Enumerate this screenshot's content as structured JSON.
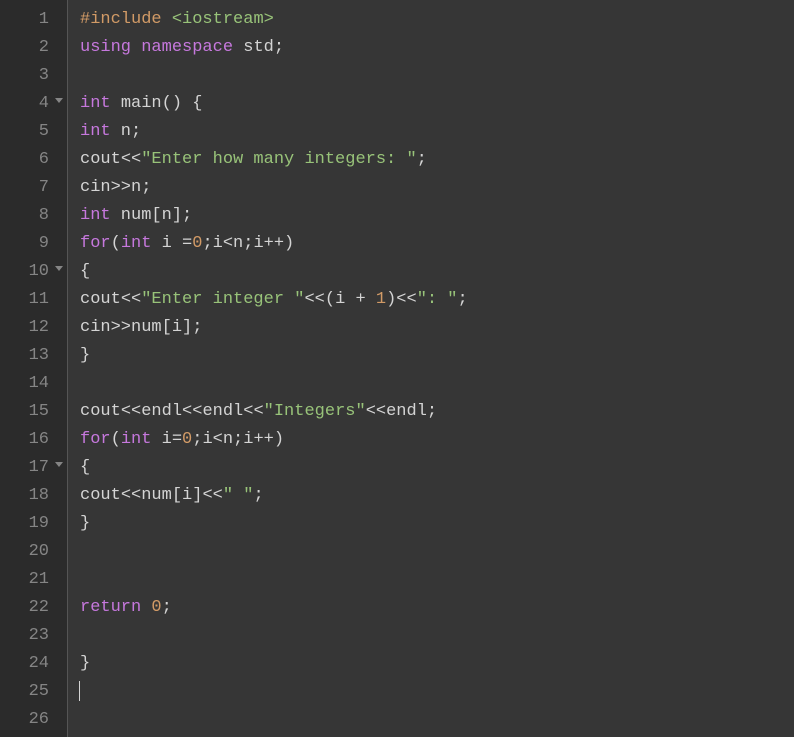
{
  "gutter": {
    "lines": [
      "1",
      "2",
      "3",
      "4",
      "5",
      "6",
      "7",
      "8",
      "9",
      "10",
      "11",
      "12",
      "13",
      "14",
      "15",
      "16",
      "17",
      "18",
      "19",
      "20",
      "21",
      "22",
      "23",
      "24",
      "25",
      "26"
    ],
    "fold_lines": [
      4,
      10,
      17
    ]
  },
  "code": {
    "lines": [
      [
        {
          "t": "#include ",
          "c": "kw-orange"
        },
        {
          "t": "<iostream>",
          "c": "string"
        }
      ],
      [
        {
          "t": "using",
          "c": "kw-blue"
        },
        {
          "t": " ",
          "c": "ident"
        },
        {
          "t": "namespace",
          "c": "kw-blue"
        },
        {
          "t": " std",
          "c": "ident"
        },
        {
          "t": ";",
          "c": "punct"
        }
      ],
      [],
      [
        {
          "t": "int",
          "c": "kw-blue"
        },
        {
          "t": " ",
          "c": "ident"
        },
        {
          "t": "main",
          "c": "fn-name"
        },
        {
          "t": "() {",
          "c": "punct"
        }
      ],
      [
        {
          "t": "int",
          "c": "kw-blue"
        },
        {
          "t": " n",
          "c": "ident"
        },
        {
          "t": ";",
          "c": "punct"
        }
      ],
      [
        {
          "t": "cout",
          "c": "ident"
        },
        {
          "t": "<<",
          "c": "op"
        },
        {
          "t": "\"Enter how many integers: \"",
          "c": "string"
        },
        {
          "t": ";",
          "c": "punct"
        }
      ],
      [
        {
          "t": "cin",
          "c": "ident"
        },
        {
          "t": ">>",
          "c": "op"
        },
        {
          "t": "n",
          "c": "ident"
        },
        {
          "t": ";",
          "c": "punct"
        }
      ],
      [
        {
          "t": "int",
          "c": "kw-blue"
        },
        {
          "t": " num",
          "c": "ident"
        },
        {
          "t": "[",
          "c": "punct"
        },
        {
          "t": "n",
          "c": "ident"
        },
        {
          "t": "];",
          "c": "punct"
        }
      ],
      [
        {
          "t": "for",
          "c": "kw-blue"
        },
        {
          "t": "(",
          "c": "punct"
        },
        {
          "t": "int",
          "c": "kw-blue"
        },
        {
          "t": " i ",
          "c": "ident"
        },
        {
          "t": "=",
          "c": "op"
        },
        {
          "t": "0",
          "c": "number"
        },
        {
          "t": ";",
          "c": "punct"
        },
        {
          "t": "i",
          "c": "ident"
        },
        {
          "t": "<",
          "c": "op"
        },
        {
          "t": "n",
          "c": "ident"
        },
        {
          "t": ";",
          "c": "punct"
        },
        {
          "t": "i",
          "c": "ident"
        },
        {
          "t": "++)",
          "c": "punct"
        }
      ],
      [
        {
          "t": "{",
          "c": "punct"
        }
      ],
      [
        {
          "t": "cout",
          "c": "ident"
        },
        {
          "t": "<<",
          "c": "op"
        },
        {
          "t": "\"Enter integer \"",
          "c": "string"
        },
        {
          "t": "<<",
          "c": "op"
        },
        {
          "t": "(",
          "c": "punct"
        },
        {
          "t": "i ",
          "c": "ident"
        },
        {
          "t": "+",
          "c": "op"
        },
        {
          "t": " ",
          "c": "ident"
        },
        {
          "t": "1",
          "c": "number"
        },
        {
          "t": ")",
          "c": "punct"
        },
        {
          "t": "<<",
          "c": "op"
        },
        {
          "t": "\": \"",
          "c": "string"
        },
        {
          "t": ";",
          "c": "punct"
        }
      ],
      [
        {
          "t": "cin",
          "c": "ident"
        },
        {
          "t": ">>",
          "c": "op"
        },
        {
          "t": "num",
          "c": "ident"
        },
        {
          "t": "[",
          "c": "punct"
        },
        {
          "t": "i",
          "c": "ident"
        },
        {
          "t": "];",
          "c": "punct"
        }
      ],
      [
        {
          "t": "}",
          "c": "punct"
        }
      ],
      [],
      [
        {
          "t": "cout",
          "c": "ident"
        },
        {
          "t": "<<",
          "c": "op"
        },
        {
          "t": "endl",
          "c": "ident"
        },
        {
          "t": "<<",
          "c": "op"
        },
        {
          "t": "endl",
          "c": "ident"
        },
        {
          "t": "<<",
          "c": "op"
        },
        {
          "t": "\"Integers\"",
          "c": "string"
        },
        {
          "t": "<<",
          "c": "op"
        },
        {
          "t": "endl",
          "c": "ident"
        },
        {
          "t": ";",
          "c": "punct"
        }
      ],
      [
        {
          "t": "for",
          "c": "kw-blue"
        },
        {
          "t": "(",
          "c": "punct"
        },
        {
          "t": "int",
          "c": "kw-blue"
        },
        {
          "t": " i",
          "c": "ident"
        },
        {
          "t": "=",
          "c": "op"
        },
        {
          "t": "0",
          "c": "number"
        },
        {
          "t": ";",
          "c": "punct"
        },
        {
          "t": "i",
          "c": "ident"
        },
        {
          "t": "<",
          "c": "op"
        },
        {
          "t": "n",
          "c": "ident"
        },
        {
          "t": ";",
          "c": "punct"
        },
        {
          "t": "i",
          "c": "ident"
        },
        {
          "t": "++)",
          "c": "punct"
        }
      ],
      [
        {
          "t": "{",
          "c": "punct"
        }
      ],
      [
        {
          "t": "cout",
          "c": "ident"
        },
        {
          "t": "<<",
          "c": "op"
        },
        {
          "t": "num",
          "c": "ident"
        },
        {
          "t": "[",
          "c": "punct"
        },
        {
          "t": "i",
          "c": "ident"
        },
        {
          "t": "]",
          "c": "punct"
        },
        {
          "t": "<<",
          "c": "op"
        },
        {
          "t": "\" \"",
          "c": "string"
        },
        {
          "t": ";",
          "c": "punct"
        }
      ],
      [
        {
          "t": "}",
          "c": "punct"
        }
      ],
      [],
      [],
      [
        {
          "t": "return",
          "c": "kw-blue"
        },
        {
          "t": " ",
          "c": "ident"
        },
        {
          "t": "0",
          "c": "number"
        },
        {
          "t": ";",
          "c": "punct"
        }
      ],
      [],
      [
        {
          "t": "}",
          "c": "punct"
        }
      ],
      [
        {
          "t": "",
          "c": "ident",
          "cursor": true
        }
      ],
      []
    ]
  }
}
